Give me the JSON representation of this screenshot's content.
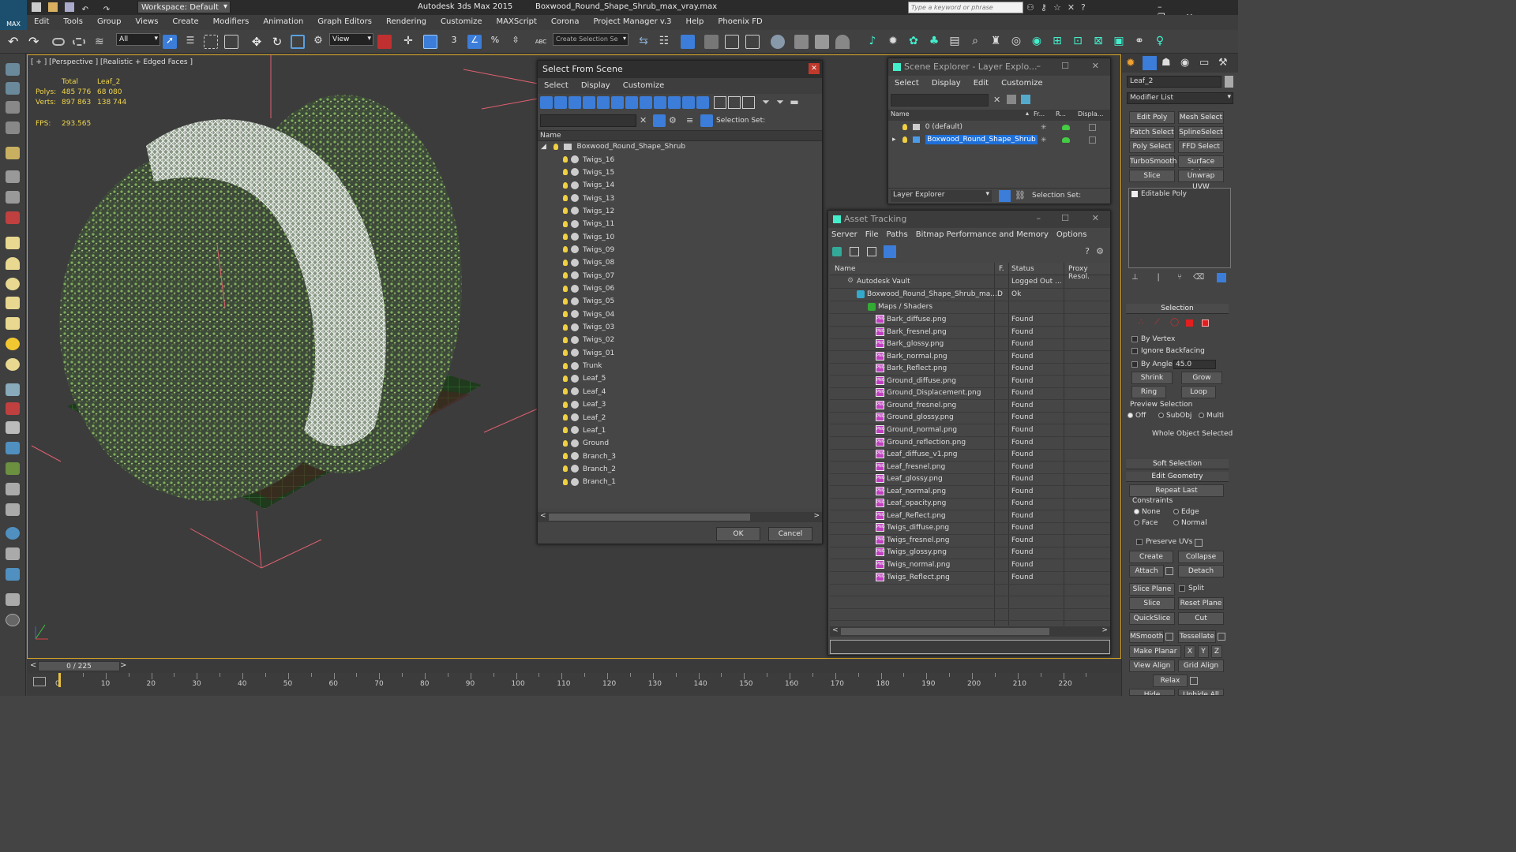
{
  "app": {
    "workspace_label": "Workspace: Default",
    "app_title": "Autodesk 3ds Max  2015",
    "file_title": "Boxwood_Round_Shape_Shrub_max_vray.max",
    "search_placeholder": "Type a keyword or phrase",
    "logo_label": "MAX"
  },
  "menubar": [
    "Edit",
    "Tools",
    "Group",
    "Views",
    "Create",
    "Modifiers",
    "Animation",
    "Graph Editors",
    "Rendering",
    "Customize",
    "MAXScript",
    "Corona",
    "Project Manager v.3",
    "Help",
    "Phoenix FD"
  ],
  "toolbar": {
    "filter_value": "All",
    "view_value": "View",
    "selection_set_placeholder": "Create Selection Se",
    "snap_label": "3",
    "percent_label": "%",
    "abc_label": "ABC"
  },
  "viewport": {
    "label": "[ + ] [Perspective ] [Realistic + Edged Faces ]",
    "stats_total": "Total",
    "stats_obj": "Leaf_2",
    "polys_label": "Polys:",
    "polys_total": "485 776",
    "polys_obj": "68 080",
    "verts_label": "Verts:",
    "verts_total": "897 863",
    "verts_obj": "138 744",
    "fps_label": "FPS:",
    "fps_value": "293.565"
  },
  "select_from_scene": {
    "title": "Select From Scene",
    "menu": [
      "Select",
      "Display",
      "Customize"
    ],
    "selection_set_label": "Selection Set:",
    "column_name": "Name",
    "root": "Boxwood_Round_Shape_Shrub",
    "items": [
      "Twigs_16",
      "Twigs_15",
      "Twigs_14",
      "Twigs_13",
      "Twigs_12",
      "Twigs_11",
      "Twigs_10",
      "Twigs_09",
      "Twigs_08",
      "Twigs_07",
      "Twigs_06",
      "Twigs_05",
      "Twigs_04",
      "Twigs_03",
      "Twigs_02",
      "Twigs_01",
      "Trunk",
      "Leaf_5",
      "Leaf_4",
      "Leaf_3",
      "Leaf_2",
      "Leaf_1",
      "Ground",
      "Branch_3",
      "Branch_2",
      "Branch_1"
    ],
    "ok_label": "OK",
    "cancel_label": "Cancel"
  },
  "scene_explorer": {
    "title": "Scene Explorer - Layer Explo...",
    "menu": [
      "Select",
      "Display",
      "Edit",
      "Customize"
    ],
    "columns": [
      "Name",
      "Fr...",
      "R...",
      "Displa..."
    ],
    "rows": [
      "0 (default)",
      "Boxwood_Round_Shape_Shrub"
    ],
    "footer_dropdown": "Layer Explorer",
    "footer_selection_set": "Selection Set:"
  },
  "asset_tracking": {
    "title": "Asset Tracking",
    "menu": [
      "Server",
      "File",
      "Paths",
      "Bitmap Performance and Memory",
      "Options"
    ],
    "columns": [
      "Name",
      "F.",
      "Status",
      "Proxy Resol."
    ],
    "vault_name": "Autodesk Vault",
    "vault_status": "Logged Out ...",
    "file_name": "Boxwood_Round_Shape_Shrub_ma...",
    "file_flag": "D",
    "file_status": "Ok",
    "group_name": "Maps / Shaders",
    "png_label": "PNG",
    "maps": [
      "Bark_diffuse.png",
      "Bark_fresnel.png",
      "Bark_glossy.png",
      "Bark_normal.png",
      "Bark_Reflect.png",
      "Ground_diffuse.png",
      "Ground_Displacement.png",
      "Ground_fresnel.png",
      "Ground_glossy.png",
      "Ground_normal.png",
      "Ground_reflection.png",
      "Leaf_diffuse_v1.png",
      "Leaf_fresnel.png",
      "Leaf_glossy.png",
      "Leaf_normal.png",
      "Leaf_opacity.png",
      "Leaf_Reflect.png",
      "Twigs_diffuse.png",
      "Twigs_fresnel.png",
      "Twigs_glossy.png",
      "Twigs_normal.png",
      "Twigs_Reflect.png"
    ],
    "map_status": "Found"
  },
  "command_panel": {
    "object_name": "Leaf_2",
    "modifier_list": "Modifier List",
    "modifier_buttons": [
      "Edit Poly",
      "Mesh Select",
      "Patch Select",
      "SplineSelect",
      "Poly Select",
      "FFD Select",
      "TurboSmooth",
      "Surface Select",
      "Slice",
      "Unwrap UVW"
    ],
    "stack_item": "Editable Poly",
    "selection_header": "Selection",
    "by_vertex": "By Vertex",
    "ignore_backfacing": "Ignore Backfacing",
    "by_angle": "By Angle:",
    "angle_value": "45.0",
    "shrink": "Shrink",
    "grow": "Grow",
    "ring": "Ring",
    "loop": "Loop",
    "preview_selection": "Preview Selection",
    "preview_off": "Off",
    "preview_subobj": "SubObj",
    "preview_multi": "Multi",
    "whole_object": "Whole Object Selected",
    "soft_selection": "Soft Selection",
    "edit_geometry": "Edit Geometry",
    "repeat_last": "Repeat Last",
    "constraints": "Constraints",
    "c_none": "None",
    "c_edge": "Edge",
    "c_face": "Face",
    "c_normal": "Normal",
    "preserve_uvs": "Preserve UVs",
    "create": "Create",
    "collapse": "Collapse",
    "attach": "Attach",
    "detach": "Detach",
    "slice_plane": "Slice Plane",
    "split": "Split",
    "slice": "Slice",
    "reset_plane": "Reset Plane",
    "quickslice": "QuickSlice",
    "cut": "Cut",
    "msmooth": "MSmooth",
    "tessellate": "Tessellate",
    "make_planar": "Make Planar",
    "x": "X",
    "y": "Y",
    "z": "Z",
    "view_align": "View Align",
    "grid_align": "Grid Align",
    "relax": "Relax",
    "hide_selected": "Hide Selected",
    "unhide_all": "Unhide All"
  },
  "timeline": {
    "frame_counter": "0 / 225",
    "ticks": [
      "0",
      "10",
      "20",
      "30",
      "40",
      "50",
      "60",
      "70",
      "80",
      "90",
      "100",
      "110",
      "120",
      "130",
      "140",
      "150",
      "160",
      "170",
      "180",
      "190",
      "200",
      "210",
      "220"
    ]
  },
  "colors": {
    "accent": "#3b7dd8",
    "viewport_border": "#d9a520",
    "found": "#dddddd"
  }
}
